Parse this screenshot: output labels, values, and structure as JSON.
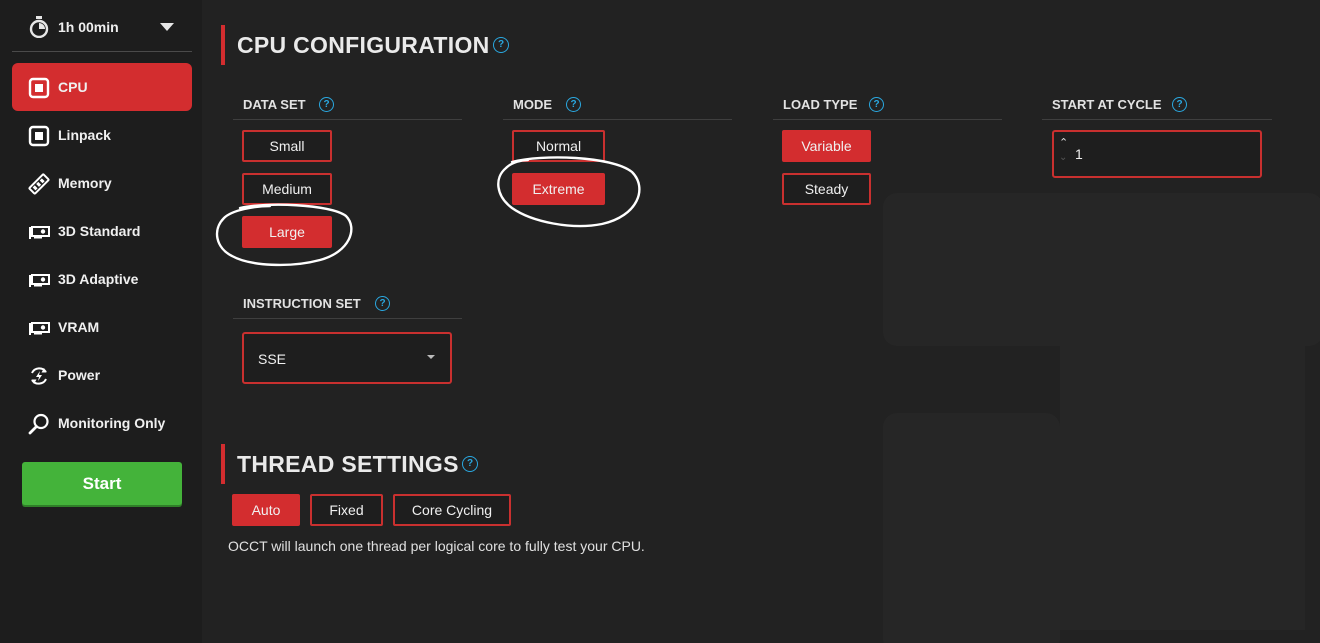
{
  "sidebar": {
    "timer": {
      "label": "1h 00min",
      "icon": "stopwatch-icon"
    },
    "items": [
      {
        "label": "CPU",
        "icon": "cpu-chip-icon",
        "active": true
      },
      {
        "label": "Linpack",
        "icon": "cpu-chip-icon",
        "active": false
      },
      {
        "label": "Memory",
        "icon": "memory-stick-icon",
        "active": false
      },
      {
        "label": "3D Standard",
        "icon": "gpu-card-icon",
        "active": false
      },
      {
        "label": "3D Adaptive",
        "icon": "gpu-card-icon",
        "active": false
      },
      {
        "label": "VRAM",
        "icon": "gpu-card-icon",
        "active": false
      },
      {
        "label": "Power",
        "icon": "power-cycle-icon",
        "active": false
      },
      {
        "label": "Monitoring Only",
        "icon": "magnifier-icon",
        "active": false
      }
    ],
    "start_label": "Start"
  },
  "cpu_config": {
    "title": "CPU CONFIGURATION",
    "data_set": {
      "label": "DATA SET",
      "options": [
        "Small",
        "Medium",
        "Large"
      ],
      "selected": "Large"
    },
    "mode": {
      "label": "MODE",
      "options": [
        "Normal",
        "Extreme"
      ],
      "selected": "Extreme"
    },
    "load_type": {
      "label": "LOAD TYPE",
      "options": [
        "Variable",
        "Steady"
      ],
      "selected": "Variable"
    },
    "start_at_cycle": {
      "label": "START AT CYCLE",
      "value": "1"
    },
    "instruction_set": {
      "label": "INSTRUCTION SET",
      "value": "SSE"
    }
  },
  "thread_settings": {
    "title": "THREAD SETTINGS",
    "options": [
      "Auto",
      "Fixed",
      "Core Cycling"
    ],
    "selected": "Auto",
    "description": "OCCT will launch one thread per logical core to fully test your CPU."
  },
  "colors": {
    "accent": "#d32d2f",
    "start": "#44b33a",
    "help": "#2aa8e0",
    "background": "#222222",
    "sidebar": "#1d1d1d"
  },
  "help_glyph": "?"
}
